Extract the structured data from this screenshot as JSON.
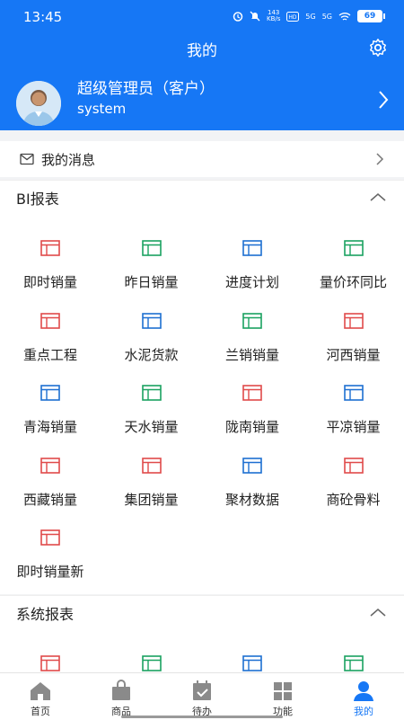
{
  "status_bar": {
    "time": "13:45",
    "speed_value": "143",
    "speed_unit": "KB/s",
    "network_a": "5G",
    "network_b": "5G",
    "battery": "69"
  },
  "header": {
    "title": "我的",
    "settings_icon": "gear-icon"
  },
  "profile": {
    "name": "超级管理员（客户）",
    "account": "system",
    "avatar_icon": "user-avatar"
  },
  "messages": {
    "label": "我的消息",
    "icon": "mail-icon"
  },
  "bi_section": {
    "title": "BI报表",
    "items": [
      {
        "label": "即时销量",
        "color": "#e04a4a"
      },
      {
        "label": "昨日销量",
        "color": "#1aa260"
      },
      {
        "label": "进度计划",
        "color": "#1d6fd1"
      },
      {
        "label": "量价环同比",
        "color": "#1aa260"
      },
      {
        "label": "重点工程",
        "color": "#e04a4a"
      },
      {
        "label": "水泥货款",
        "color": "#1d6fd1"
      },
      {
        "label": "兰销销量",
        "color": "#1aa260"
      },
      {
        "label": "河西销量",
        "color": "#e04a4a"
      },
      {
        "label": "青海销量",
        "color": "#1d6fd1"
      },
      {
        "label": "天水销量",
        "color": "#1aa260"
      },
      {
        "label": "陇南销量",
        "color": "#e04a4a"
      },
      {
        "label": "平凉销量",
        "color": "#1d6fd1"
      },
      {
        "label": "西藏销量",
        "color": "#e04a4a"
      },
      {
        "label": "集团销量",
        "color": "#e04a4a"
      },
      {
        "label": "聚材数据",
        "color": "#1d6fd1"
      },
      {
        "label": "商砼骨料",
        "color": "#e04a4a"
      },
      {
        "label": "即时销量新",
        "color": "#e04a4a"
      }
    ]
  },
  "system_section": {
    "title": "系统报表",
    "items": [
      {
        "color": "#e04a4a"
      },
      {
        "color": "#1aa260"
      },
      {
        "color": "#1d6fd1"
      },
      {
        "color": "#1aa260"
      }
    ]
  },
  "tabbar": {
    "tabs": [
      {
        "label": "首页",
        "icon": "home-icon",
        "active": false
      },
      {
        "label": "商品",
        "icon": "bag-icon",
        "active": false
      },
      {
        "label": "待办",
        "icon": "calendar-check-icon",
        "active": false
      },
      {
        "label": "功能",
        "icon": "grid-icon",
        "active": false
      },
      {
        "label": "我的",
        "icon": "person-icon",
        "active": true
      }
    ]
  },
  "colors": {
    "primary": "#1677f5",
    "red": "#e04a4a",
    "green": "#1aa260",
    "blue": "#1d6fd1"
  }
}
